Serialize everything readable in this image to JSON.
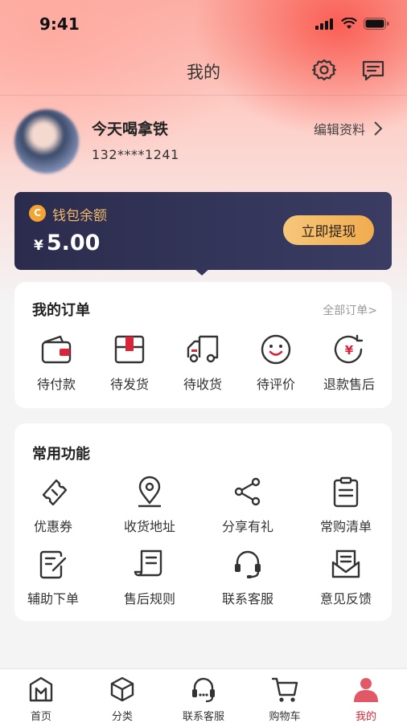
{
  "status_bar": {
    "time": "9:41"
  },
  "nav": {
    "title": "我的"
  },
  "profile": {
    "name": "今天喝拿铁",
    "phone": "132****1241",
    "edit_label": "编辑资料"
  },
  "wallet": {
    "label": "钱包余额",
    "currency": "¥",
    "amount": "5.00",
    "button": "立即提现",
    "coin_symbol": "C"
  },
  "orders": {
    "title": "我的订单",
    "all_link": "全部订单>",
    "items": [
      {
        "label": "待付款",
        "icon": "wallet-icon"
      },
      {
        "label": "待发货",
        "icon": "package-icon"
      },
      {
        "label": "待收货",
        "icon": "truck-icon"
      },
      {
        "label": "待评价",
        "icon": "smile-icon"
      },
      {
        "label": "退款售后",
        "icon": "refund-icon"
      }
    ]
  },
  "functions": {
    "title": "常用功能",
    "items": [
      {
        "label": "优惠券",
        "icon": "coupon-icon"
      },
      {
        "label": "收货地址",
        "icon": "location-icon"
      },
      {
        "label": "分享有礼",
        "icon": "share-icon"
      },
      {
        "label": "常购清单",
        "icon": "clipboard-icon"
      },
      {
        "label": "辅助下单",
        "icon": "edit-note-icon"
      },
      {
        "label": "售后规则",
        "icon": "document-icon"
      },
      {
        "label": "联系客服",
        "icon": "headset-icon"
      },
      {
        "label": "意见反馈",
        "icon": "mail-icon"
      }
    ]
  },
  "tabbar": {
    "items": [
      {
        "label": "首页",
        "icon": "home-icon"
      },
      {
        "label": "分类",
        "icon": "category-icon"
      },
      {
        "label": "联系客服",
        "icon": "service-icon"
      },
      {
        "label": "购物车",
        "icon": "cart-icon"
      },
      {
        "label": "我的",
        "icon": "user-icon",
        "active": true
      }
    ]
  },
  "colors": {
    "accent": "#d9243a",
    "wallet_bg": "#2b2c4d",
    "gold": "#f1ac4e"
  }
}
